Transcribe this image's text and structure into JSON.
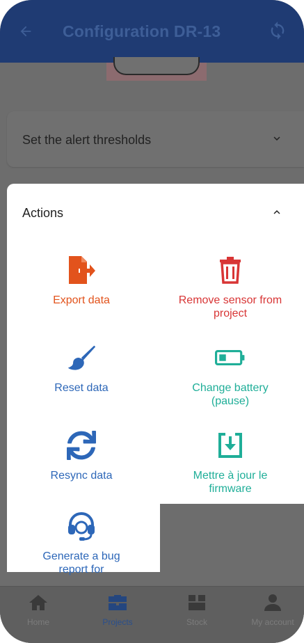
{
  "appbar": {
    "title": "Configuration DR-13",
    "back_icon": "arrow-left-icon",
    "sync_icon": "sync-icon"
  },
  "sections": {
    "alert_thresholds": "Set the alert thresholds",
    "actions": "Actions"
  },
  "actions": {
    "export": {
      "label": "Export data",
      "icon": "file-export-icon",
      "color": "#e2531c"
    },
    "remove": {
      "label": "Remove sensor from project",
      "icon": "trash-icon",
      "color": "#d83535"
    },
    "reset": {
      "label": "Reset data",
      "icon": "paint-brush-icon",
      "color": "#2d67b8"
    },
    "battery": {
      "label": "Change battery (pause)",
      "icon": "battery-icon",
      "color": "#1fae98"
    },
    "resync": {
      "label": "Resync data",
      "icon": "sync-icon",
      "color": "#2d67b8"
    },
    "firmware": {
      "label": "Mettre à jour le firmware",
      "icon": "download-box-icon",
      "color": "#1fae98"
    },
    "bugreport": {
      "label": "Generate a bug report for",
      "icon": "headset-icon",
      "color": "#2d67b8"
    }
  },
  "bottomnav": {
    "items": [
      {
        "label": "Home",
        "icon": "home-icon"
      },
      {
        "label": "Projects",
        "icon": "briefcase-icon",
        "active": true
      },
      {
        "label": "Stock",
        "icon": "box-icon"
      },
      {
        "label": "My account",
        "icon": "user-icon"
      }
    ]
  },
  "colors": {
    "appbar": "#1f3b73",
    "overlay": "#6d6d6d",
    "active_nav": "#2a4f8c"
  }
}
